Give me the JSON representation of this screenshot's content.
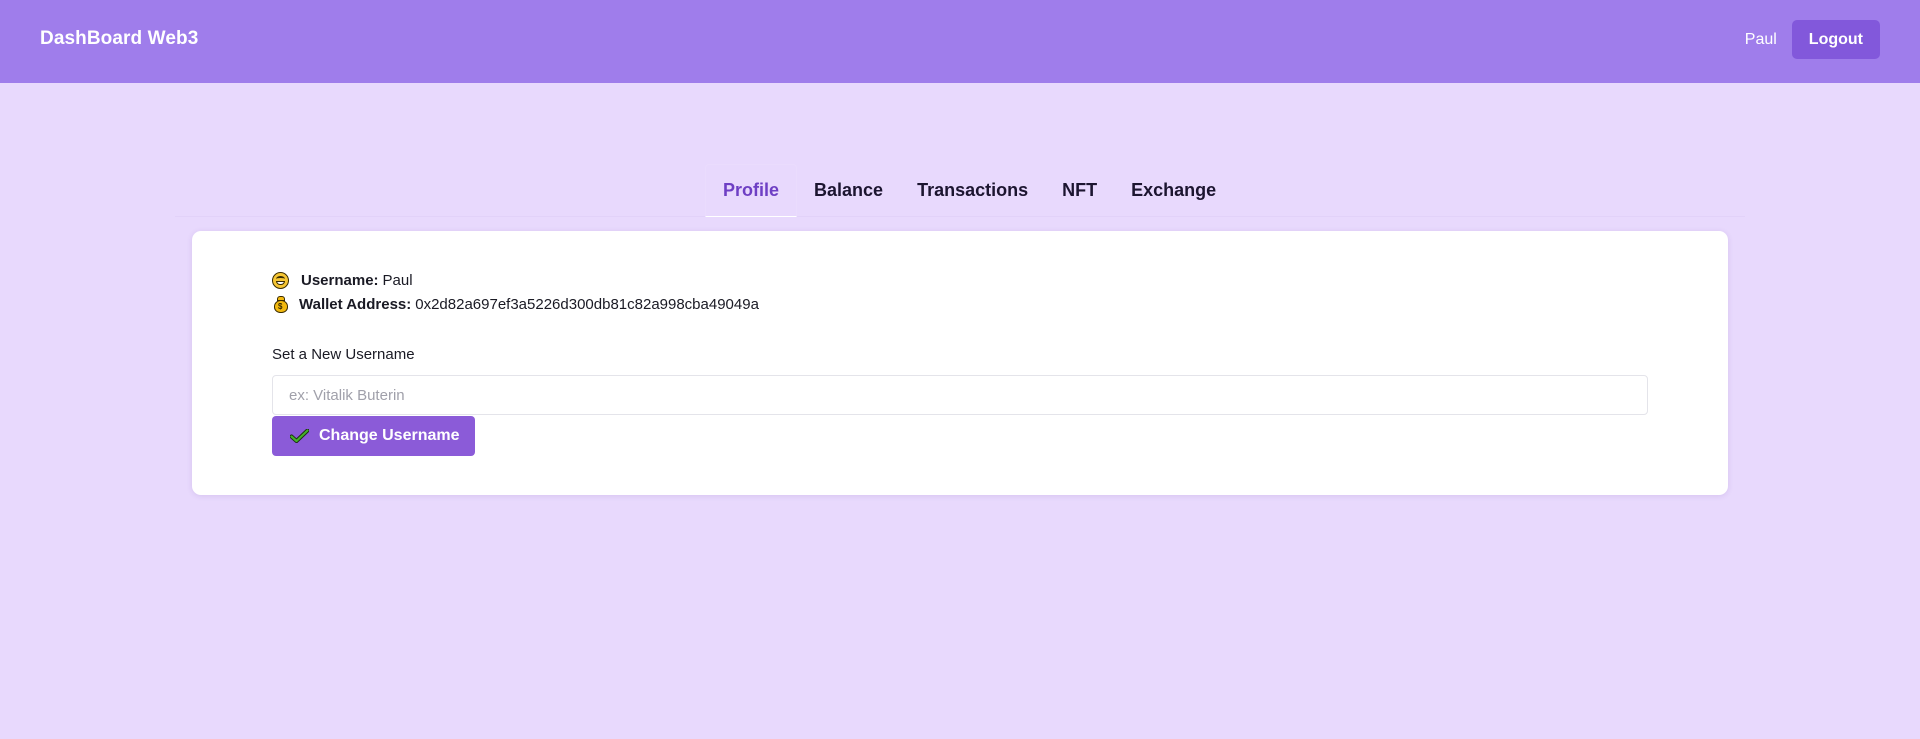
{
  "header": {
    "brand": "DashBoard Web3",
    "user_name": "Paul",
    "logout_label": "Logout"
  },
  "tabs": [
    {
      "label": "Profile",
      "active": true
    },
    {
      "label": "Balance",
      "active": false
    },
    {
      "label": "Transactions",
      "active": false
    },
    {
      "label": "NFT",
      "active": false
    },
    {
      "label": "Exchange",
      "active": false
    }
  ],
  "profile": {
    "username_key": "Username:",
    "username_value": "Paul",
    "wallet_key": "Wallet Address:",
    "wallet_value": "0x2d82a697ef3a5226d300db81c82a998cba49049a",
    "form_label": "Set a New Username",
    "input_placeholder": "ex: Vitalik Buterin",
    "input_value": "",
    "submit_label": "Change Username"
  },
  "icons": {
    "username": "grinning-face-icon",
    "wallet": "money-bag-icon",
    "submit": "check-mark-icon"
  },
  "colors": {
    "header_bg": "#9f7deb",
    "page_bg": "#e8d9fd",
    "accent": "#8b5bd8",
    "active_tab": "#6e3fc4"
  }
}
